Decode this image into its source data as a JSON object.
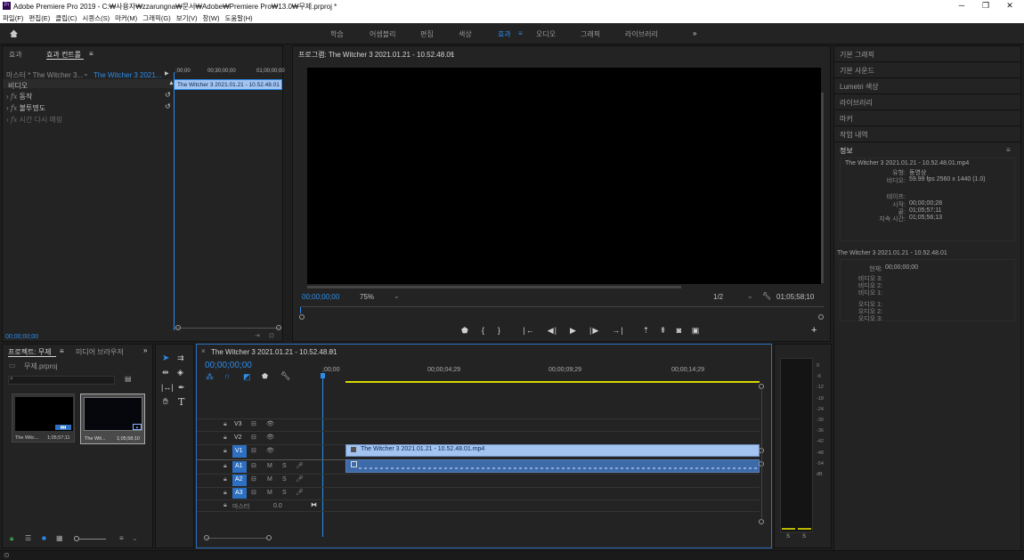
{
  "window": {
    "title": "Adobe Premiere Pro 2019 - C:₩사용자₩zzarungna₩문서₩Adobe₩Premiere Pro₩13.0₩무제.prproj *",
    "minimize": "─",
    "maximize": "❐",
    "close": "✕"
  },
  "menu": [
    "파일(F)",
    "편집(E)",
    "클립(C)",
    "시퀀스(S)",
    "마커(M)",
    "그래픽(G)",
    "보기(V)",
    "창(W)",
    "도움말(H)"
  ],
  "workspaces": {
    "items": [
      "학습",
      "어셈블리",
      "편집",
      "색상",
      "효과",
      "오디오",
      "그래픽",
      "라이브러리"
    ],
    "active": "효과",
    "more": "»"
  },
  "effect_controls": {
    "tab_effects": "효과",
    "tab_controls": "효과 컨트롤",
    "menu_icon": "≡",
    "master_label": "마스터 * The Witcher 3...",
    "clip_label": "The Witcher 3 2021...",
    "section": "비디오",
    "items": [
      "동작",
      "불투명도",
      "시간 다시 매핑"
    ],
    "time0": ";00;00",
    "time1": "00;30;00;00",
    "time2": "01;00;00;00",
    "clip_bar": "The Witcher 3 2021.01.21 - 10.52.48.01",
    "timecode": "00;00;00;00"
  },
  "program": {
    "title": "프로그램: The Witcher 3 2021.01.21 - 10.52.48.01",
    "menu_icon": "≡",
    "timecode": "00;00;00;00",
    "zoom": "75%",
    "resolution": "1/2",
    "duration": "01;05;58;10",
    "add": "+"
  },
  "right": {
    "items": [
      "기본 그래픽",
      "기본 사운드",
      "Lumetri 색상",
      "라이브러리",
      "마커",
      "작업 내역"
    ],
    "info_title": "정보",
    "info_menu": "≡",
    "info": {
      "file": "The Witcher 3 2021.01.21 - 10.52.48.01.mp4",
      "type_label": "유형:",
      "type_value": "동영상",
      "video_label": "비디오:",
      "video_value": "59.99 fps 2560 x 1440 (1.0)",
      "tape_label": "테이프:",
      "start_label": "시작:",
      "start_value": "00;00;00;28",
      "end_label": "끝:",
      "end_value": "01;05;57;11",
      "dur_label": "지속 시간:",
      "dur_value": "01;05;56;13"
    },
    "seq": {
      "name": "The Witcher 3 2021.01.21 - 10.52.48.01",
      "current_label": "현재:",
      "current_value": "00;00;00;00",
      "v3": "비디오 3:",
      "v2": "비디오 2:",
      "v1": "비디오 1:",
      "a1": "오디오 1:",
      "a2": "오디오 2:",
      "a3": "오디오 3:"
    }
  },
  "project": {
    "tab": "프로젝트: 무제",
    "menu_icon": "≡",
    "tab2": "미디어 브라우저",
    "more": "»",
    "file": "무제.prproj",
    "items": [
      {
        "name": "The Witc...",
        "dur": "1;05;57;11"
      },
      {
        "name": "The Wit...",
        "dur": "1;05;58;10"
      }
    ]
  },
  "timeline": {
    "close": "×",
    "name": "The Witcher 3 2021.01.21 - 10.52.48.01",
    "menu_icon": "≡",
    "timecode": "00;00;00;00",
    "ruler": [
      ";00;00",
      "00;00;04;29",
      "00;00;09;29",
      "00;00;14;29"
    ],
    "tracks": {
      "v3": "V3",
      "v2": "V2",
      "v1": "V1",
      "a1": "A1",
      "a2": "A2",
      "a3": "A3"
    },
    "m": "M",
    "s": "S",
    "master": "마스터",
    "master_val": "0.0",
    "clip": "The Witcher 3 2021.01.21 - 10.52.48.01.mp4"
  },
  "meter": {
    "scale": [
      "0",
      "-6",
      "-12",
      "-18",
      "-24",
      "-30",
      "-36",
      "-42",
      "-48",
      "-54",
      "dB"
    ],
    "s": "S"
  },
  "colors": {
    "accent": "#2d8ceb",
    "clip_video": "#a3c4f0",
    "clip_audio": "#3d6aa8",
    "panel": "#232323"
  }
}
